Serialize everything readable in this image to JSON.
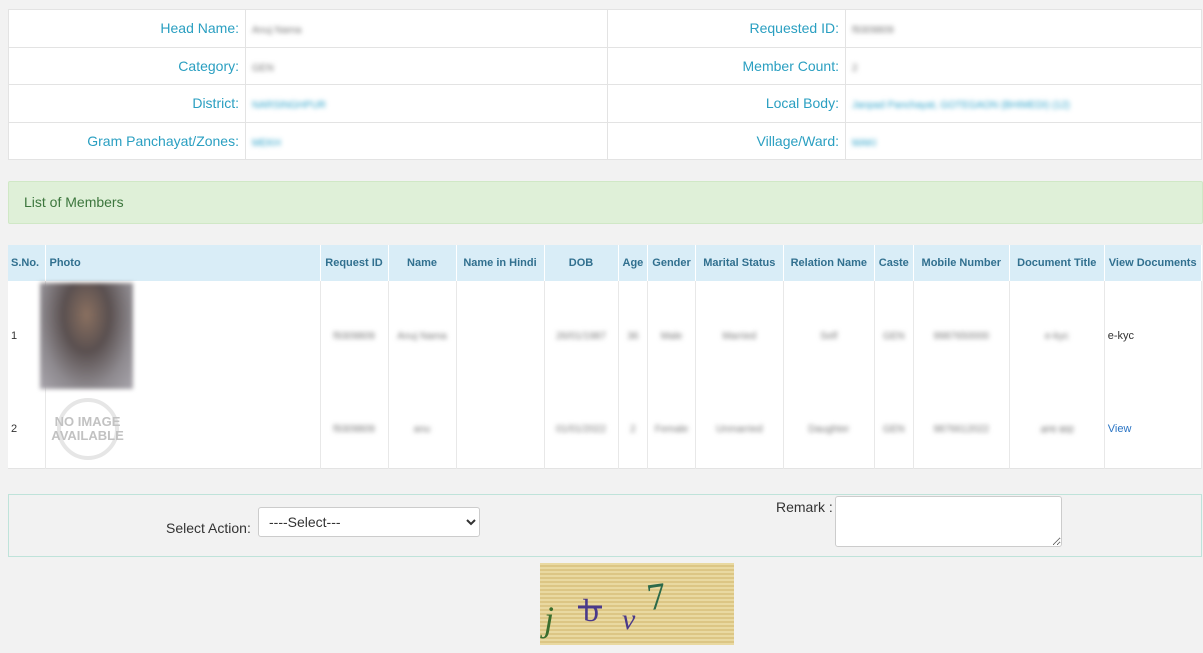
{
  "head": {
    "head_name_label": "Head Name:",
    "head_name_value": "Anuj Nama",
    "requested_id_label": "Requested ID:",
    "requested_id_value": "f9309809",
    "category_label": "Category:",
    "category_value": "GEN",
    "member_count_label": "Member Count:",
    "member_count_value": "2",
    "district_label": "District:",
    "district_value": "NARSINGHPUR",
    "local_body_label": "Local Body:",
    "local_body_value": "Janpad Panchayat, GOTEGAON (BHIMEDI) (12)",
    "gram_label": "Gram Panchayat/Zones:",
    "gram_value": "MEKH",
    "village_label": "Village/Ward:",
    "village_value": "MAKI"
  },
  "members_panel": {
    "title": "List of Members"
  },
  "members_table": {
    "headers": [
      "S.No.",
      "Photo",
      "Request ID",
      "Name",
      "Name in Hindi",
      "DOB",
      "Age",
      "Gender",
      "Marital Status",
      "Relation Name",
      "Caste",
      "Mobile Number",
      "Document Title",
      "View Documents"
    ],
    "rows": [
      {
        "sno": "1",
        "request_id": "f9309809",
        "name": "Anuj Nama",
        "name_hindi": "",
        "dob": "26/01/1987",
        "age": "36",
        "gender": "Male",
        "marital": "Married",
        "relation": "Self",
        "caste": "GEN",
        "mobile": "9987650000",
        "doc_title": "e-kyc",
        "view": "e-kyc"
      },
      {
        "sno": "2",
        "request_id": "f9309809",
        "name": "anu",
        "name_hindi": "",
        "dob": "01/01/2022",
        "age": "2",
        "gender": "Female",
        "marital": "Unmarried",
        "relation": "Daughter",
        "caste": "GEN",
        "mobile": "9876612022",
        "doc_title": "अन्य सदा",
        "view": "View"
      }
    ],
    "no_image_text": "NO IMAGE AVAILABLE"
  },
  "action": {
    "select_label": "Select Action:",
    "select_value": "----Select---",
    "remark_label": "Remark :"
  },
  "captcha": {
    "text": "jbv7"
  },
  "colors": {
    "label_blue": "#2a9fc1",
    "panel_green_bg": "#dff0d8",
    "panel_green_text": "#3c763d",
    "table_header_bg": "#d9edf7",
    "link_blue": "#2a74c4"
  }
}
